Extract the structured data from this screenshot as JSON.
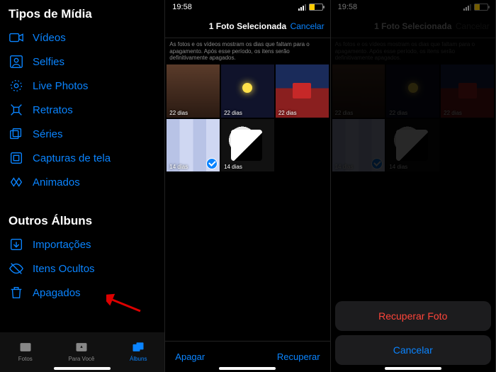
{
  "screen1": {
    "section_media": "Tipos de Mídia",
    "media_items": [
      {
        "label": "Vídeos"
      },
      {
        "label": "Selfies"
      },
      {
        "label": "Live Photos"
      },
      {
        "label": "Retratos"
      },
      {
        "label": "Séries"
      },
      {
        "label": "Capturas de tela"
      },
      {
        "label": "Animados"
      }
    ],
    "section_other": "Outros Álbuns",
    "other_items": [
      {
        "label": "Importações"
      },
      {
        "label": "Itens Ocultos"
      },
      {
        "label": "Apagados"
      }
    ],
    "tabs": {
      "fotos": "Fotos",
      "para_voce": "Para Você",
      "albuns": "Álbuns"
    }
  },
  "screen2": {
    "time": "19:58",
    "title": "1 Foto Selecionada",
    "cancel": "Cancelar",
    "info": "As fotos e os vídeos mostram os dias que faltam para o apagamento. Após esse período, os itens serão definitivamente apagados.",
    "thumbs": [
      {
        "days": "22 dias"
      },
      {
        "days": "22 dias"
      },
      {
        "days": "22 dias"
      },
      {
        "days": "14 dias",
        "selected": true
      },
      {
        "days": "14 dias"
      }
    ],
    "delete": "Apagar",
    "recover": "Recuperar"
  },
  "screen3": {
    "time": "19:58",
    "title": "1 Foto Selecionada",
    "cancel": "Cancelar",
    "info": "As fotos e os vídeos mostram os dias que faltam para o apagamento. Após esse período, os itens serão definitivamente apagados.",
    "thumbs": [
      {
        "days": "22 dias"
      },
      {
        "days": "22 dias"
      },
      {
        "days": "22 dias"
      },
      {
        "days": "14 dias",
        "selected": true
      },
      {
        "days": "14 dias"
      }
    ],
    "sheet": {
      "recover": "Recuperar Foto",
      "cancel": "Cancelar"
    }
  }
}
